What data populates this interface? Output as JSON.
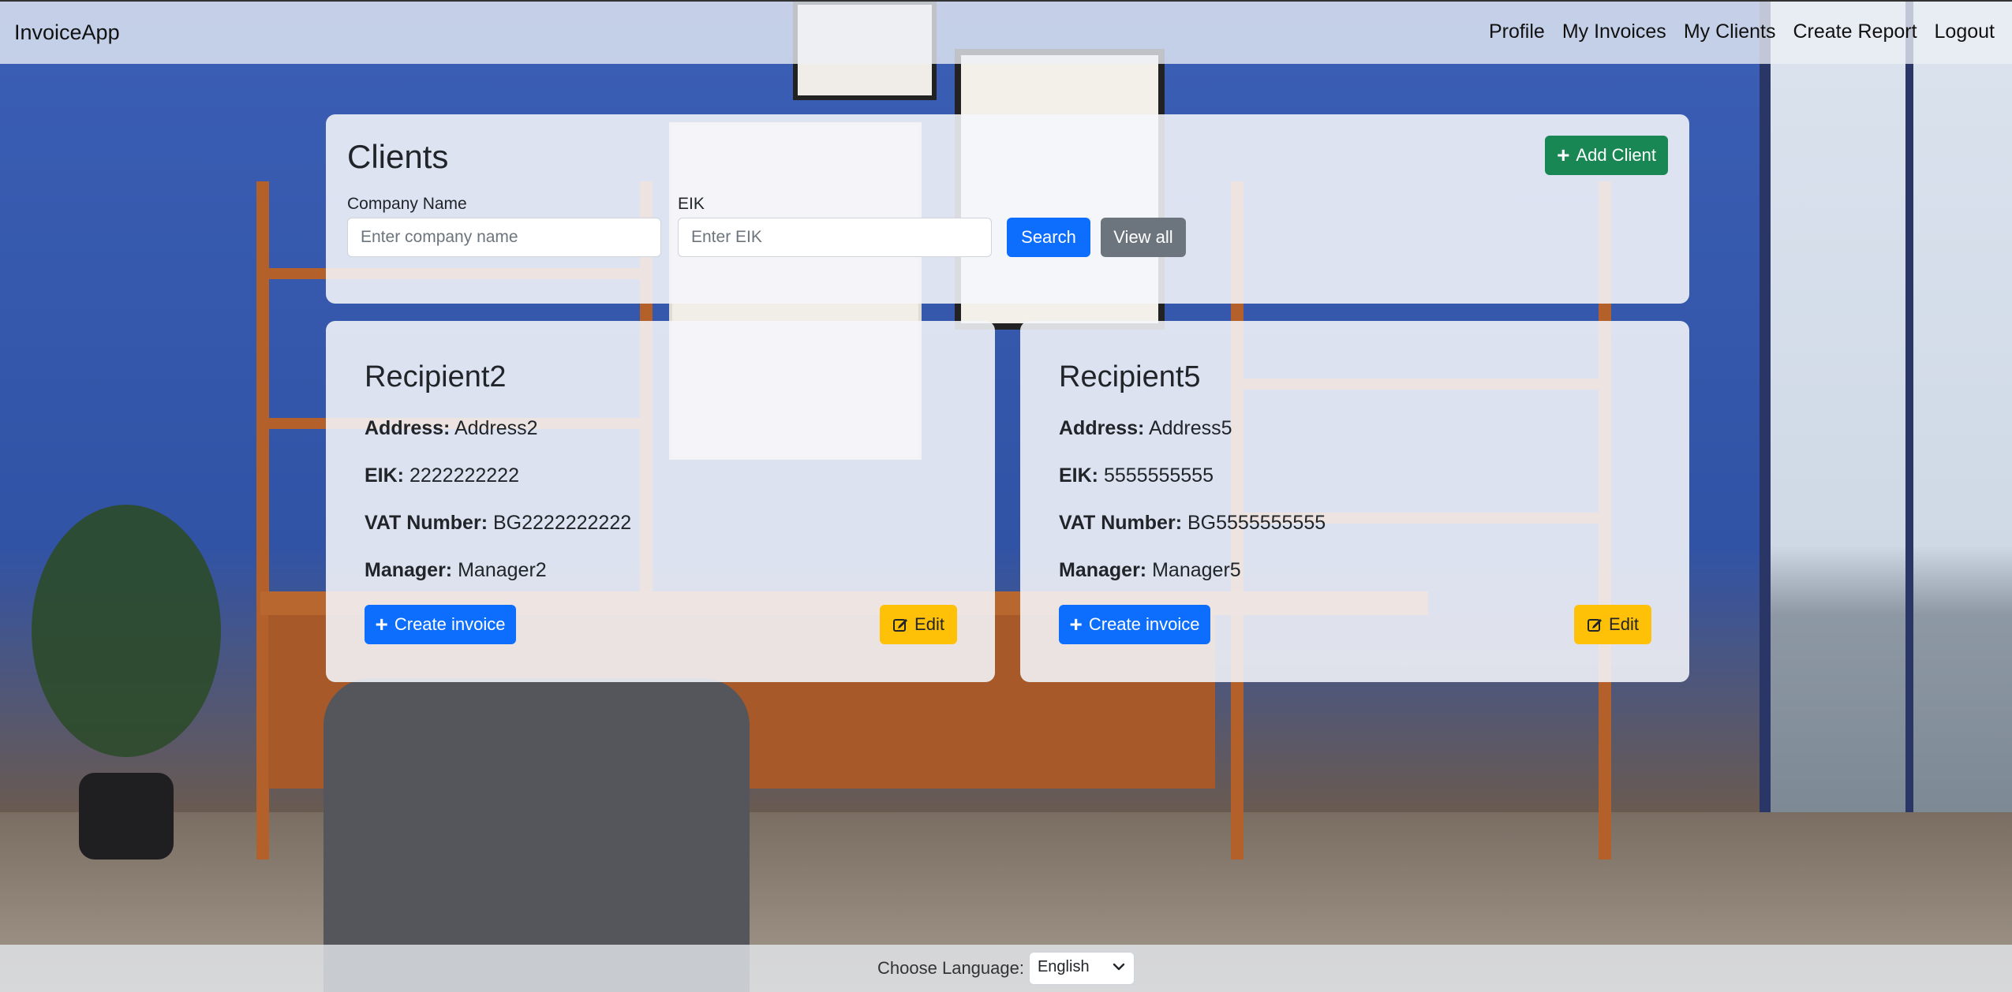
{
  "navbar": {
    "brand": "InvoiceApp",
    "links": [
      "Profile",
      "My Invoices",
      "My Clients",
      "Create Report",
      "Logout"
    ]
  },
  "search": {
    "title": "Clients",
    "company_label": "Company Name",
    "company_placeholder": "Enter company name",
    "company_value": "",
    "eik_label": "EIK",
    "eik_placeholder": "Enter EIK",
    "eik_value": "",
    "search_button": "Search",
    "view_all_button": "View all",
    "add_client_button": "Add Client"
  },
  "clients": [
    {
      "name": "Recipient2",
      "address_label": "Address:",
      "address": "Address2",
      "eik_label": "EIK:",
      "eik": "2222222222",
      "vat_label": "VAT Number:",
      "vat": "BG2222222222",
      "manager_label": "Manager:",
      "manager": "Manager2",
      "create_invoice_button": "Create invoice",
      "edit_button": "Edit"
    },
    {
      "name": "Recipient5",
      "address_label": "Address:",
      "address": "Address5",
      "eik_label": "EIK:",
      "eik": "5555555555",
      "vat_label": "VAT Number:",
      "vat": "BG5555555555",
      "manager_label": "Manager:",
      "manager": "Manager5",
      "create_invoice_button": "Create invoice",
      "edit_button": "Edit"
    }
  ],
  "footer": {
    "language_label": "Choose Language:",
    "language_selected": "English"
  },
  "icons": {
    "add": "plus-icon",
    "edit": "edit-square-icon",
    "select": "chevron-down-icon"
  },
  "colors": {
    "primary": "#0d6efd",
    "secondary": "#6c757d",
    "success": "#198754",
    "warning": "#ffc107"
  }
}
